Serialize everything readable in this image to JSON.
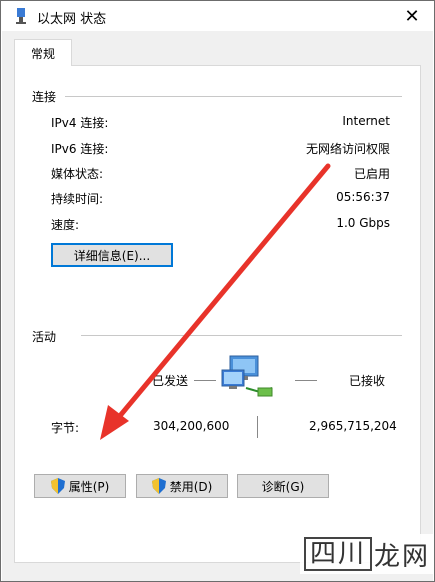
{
  "window": {
    "title": "以太网 状态"
  },
  "tabs": [
    {
      "label": "常规"
    }
  ],
  "connection": {
    "section_title": "连接",
    "rows": [
      {
        "label": "IPv4 连接:",
        "value": "Internet"
      },
      {
        "label": "IPv6 连接:",
        "value": "无网络访问权限"
      },
      {
        "label": "媒体状态:",
        "value": "已启用"
      },
      {
        "label": "持续时间:",
        "value": "05:56:37"
      },
      {
        "label": "速度:",
        "value": "1.0 Gbps"
      }
    ],
    "details_button": "详细信息(E)..."
  },
  "activity": {
    "section_title": "活动",
    "sent_label": "已发送",
    "received_label": "已接收",
    "bytes_label": "字节:",
    "bytes_sent": "304,200,600",
    "bytes_received": "2,965,715,204"
  },
  "buttons": {
    "properties": "属性(P)",
    "disable": "禁用(D)",
    "diagnose": "诊断(G)"
  },
  "watermark": {
    "box_text": "四川",
    "text": "龙网"
  },
  "icons": {
    "title": "network-adapter-icon",
    "activity": "network-computers-icon",
    "shield": "uac-shield-icon"
  },
  "colors": {
    "annotation_arrow": "#e8332a",
    "focus": "#0078d7"
  }
}
